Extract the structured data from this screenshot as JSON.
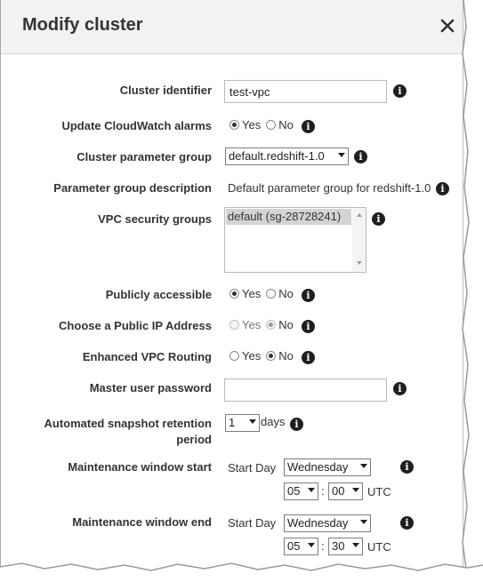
{
  "dialog": {
    "title": "Modify cluster"
  },
  "fields": {
    "cluster_identifier": {
      "label": "Cluster identifier",
      "value": "test-vpc"
    },
    "update_cloudwatch": {
      "label": "Update CloudWatch alarms",
      "yes": "Yes",
      "no": "No",
      "selected": "Yes"
    },
    "parameter_group": {
      "label": "Cluster parameter group",
      "value": "default.redshift-1.0"
    },
    "parameter_group_description": {
      "label": "Parameter group description",
      "value": "Default parameter group for redshift-1.0"
    },
    "vpc_security_groups": {
      "label": "VPC security groups",
      "options": [
        "default (sg-28728241)"
      ]
    },
    "publicly_accessible": {
      "label": "Publicly accessible",
      "yes": "Yes",
      "no": "No",
      "selected": "Yes"
    },
    "public_ip": {
      "label": "Choose a Public IP Address",
      "yes": "Yes",
      "no": "No",
      "selected": "No",
      "disabled": true
    },
    "enhanced_vpc_routing": {
      "label": "Enhanced VPC Routing",
      "yes": "Yes",
      "no": "No",
      "selected": "No"
    },
    "master_password": {
      "label": "Master user password",
      "value": ""
    },
    "snapshot_retention": {
      "label_line1": "Automated snapshot retention",
      "label_line2": "period",
      "value": "1",
      "unit": "days"
    },
    "maintenance_start": {
      "label": "Maintenance window start",
      "day_label": "Start Day",
      "day": "Wednesday",
      "hour": "05",
      "minute": "00",
      "tz": "UTC",
      "sep": ":"
    },
    "maintenance_end": {
      "label": "Maintenance window end",
      "day_label": "Start Day",
      "day": "Wednesday",
      "hour": "05",
      "minute": "30",
      "tz": "UTC",
      "sep": ":"
    }
  },
  "icons": {
    "close": "close-icon",
    "info": "info-icon",
    "info_glyph": "i"
  },
  "colors": {
    "header_bg": "#f2f2f2",
    "selected_option_bg": "#d4d4d4"
  }
}
